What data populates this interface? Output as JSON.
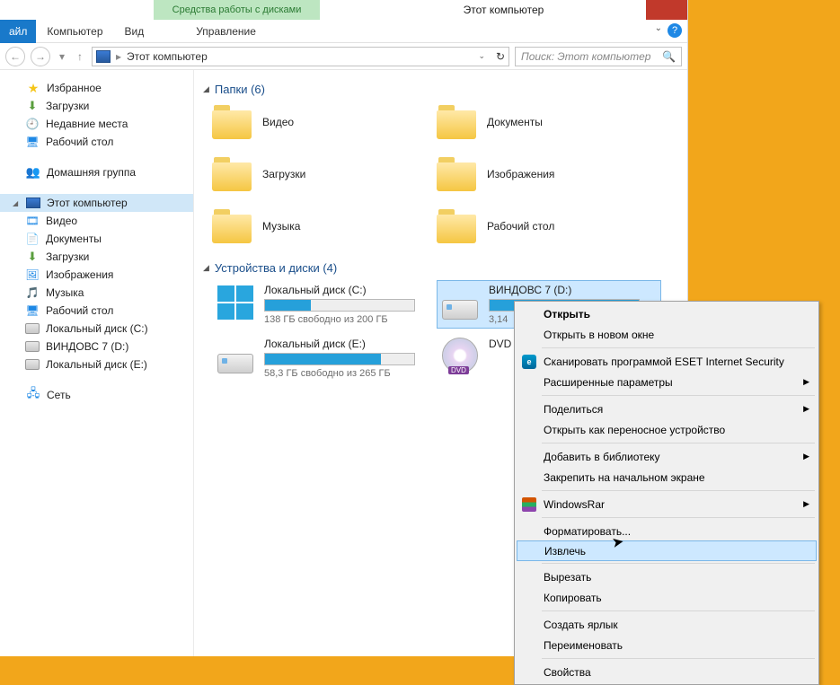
{
  "titlebar": {
    "tool_tab": "Средства работы с дисками",
    "title": "Этот компьютер"
  },
  "ribbon": {
    "file": "айл",
    "computer": "Компьютер",
    "view": "Вид",
    "manage": "Управление"
  },
  "addr": {
    "location": "Этот компьютер",
    "search_placeholder": "Поиск: Этот компьютер"
  },
  "sidebar": {
    "favorites": "Избранное",
    "downloads": "Загрузки",
    "recent": "Недавние места",
    "desktop": "Рабочий стол",
    "homegroup": "Домашняя группа",
    "thispc": "Этот компьютер",
    "tree": {
      "video": "Видео",
      "documents": "Документы",
      "downloads": "Загрузки",
      "pictures": "Изображения",
      "music": "Музыка",
      "desktop": "Рабочий стол",
      "drive_c": "Локальный диск (C:)",
      "drive_d": "ВИНДОВС 7 (D:)",
      "drive_e": "Локальный диск (E:)"
    },
    "network": "Сеть"
  },
  "sections": {
    "folders": "Папки (6)",
    "drives": "Устройства и диски (4)"
  },
  "folders": {
    "video": "Видео",
    "documents": "Документы",
    "downloads": "Загрузки",
    "pictures": "Изображения",
    "music": "Музыка",
    "desktop": "Рабочий стол"
  },
  "drives": {
    "c": {
      "name": "Локальный диск (C:)",
      "free": "138 ГБ свободно из 200 ГБ",
      "fill_pct": 31
    },
    "d": {
      "name": "ВИНДОВС 7 (D:)",
      "free": "3,14",
      "fill_pct": 100
    },
    "e": {
      "name": "Локальный диск (E:)",
      "free": "58,3 ГБ свободно из 265 ГБ",
      "fill_pct": 78
    },
    "dvd": {
      "name": "DVD"
    }
  },
  "context_menu": {
    "open": "Открыть",
    "open_new": "Открыть в новом окне",
    "eset": "Сканировать программой ESET Internet Security",
    "advanced": "Расширенные параметры",
    "share": "Поделиться",
    "portable": "Открыть как переносное устройство",
    "library": "Добавить в библиотеку",
    "pin": "Закрепить на начальном экране",
    "winrar": "WindowsRar",
    "format": "Форматировать...",
    "eject": "Извлечь",
    "cut": "Вырезать",
    "copy": "Копировать",
    "shortcut": "Создать ярлык",
    "rename": "Переименовать",
    "properties": "Свойства"
  }
}
